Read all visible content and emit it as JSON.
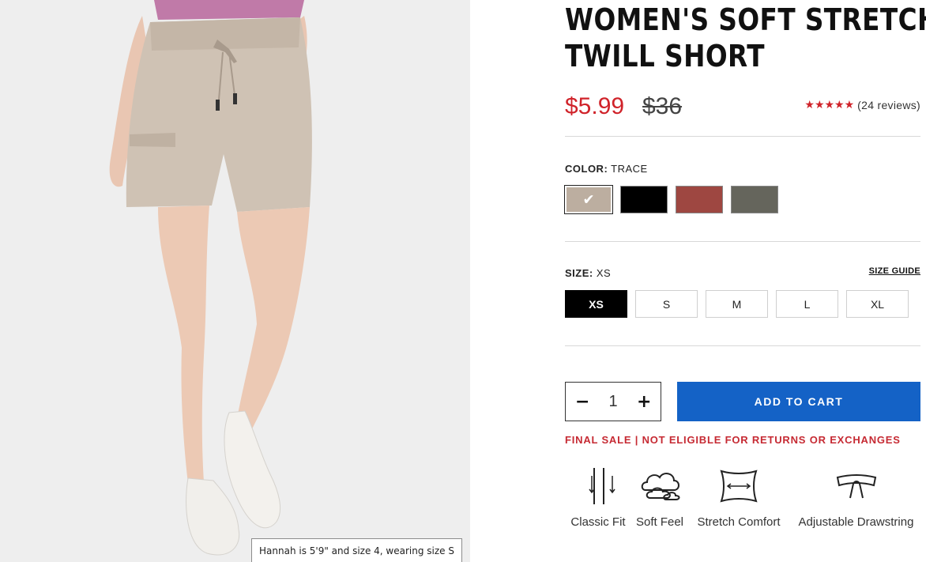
{
  "product": {
    "title_line1": "WOMEN'S SOFT STRETCH",
    "title_line2": "TWILL SHORT",
    "sale_price": "$5.99",
    "original_price": "$36",
    "stars": "★★★★★",
    "rating_value": 5,
    "review_count": "(24 reviews)"
  },
  "image": {
    "caption": "Hannah is 5'9\" and size 4, wearing size S"
  },
  "color": {
    "label": "COLOR:",
    "selected": "TRACE",
    "swatches": [
      {
        "color": "#bcaea0",
        "selected": true
      },
      {
        "color": "#000000",
        "selected": false
      },
      {
        "color": "#9e4741",
        "selected": false
      },
      {
        "color": "#65655c",
        "selected": false
      }
    ],
    "check_icon": "✔"
  },
  "size": {
    "label": "SIZE:",
    "selected": "XS",
    "guide_label": "SIZE GUIDE",
    "options": [
      "XS",
      "S",
      "M",
      "L",
      "XL"
    ]
  },
  "quantity": {
    "decrement": "−",
    "value": "1",
    "increment": "+"
  },
  "cart": {
    "button_label": "ADD TO CART"
  },
  "notice": {
    "final_sale": "FINAL SALE | NOT ELIGIBLE FOR RETURNS OR EXCHANGES"
  },
  "features": [
    {
      "icon": "classic-fit-icon",
      "label": "Classic Fit"
    },
    {
      "icon": "soft-feel-icon",
      "label": "Soft Feel"
    },
    {
      "icon": "stretch-comfort-icon",
      "label": "Stretch Comfort"
    },
    {
      "icon": "adjustable-drawstring-icon",
      "label": "Adjustable Drawstring"
    }
  ],
  "colors": {
    "accent_red": "#d0232a",
    "button_blue": "#1462c6",
    "notice_red": "#c62a33"
  }
}
